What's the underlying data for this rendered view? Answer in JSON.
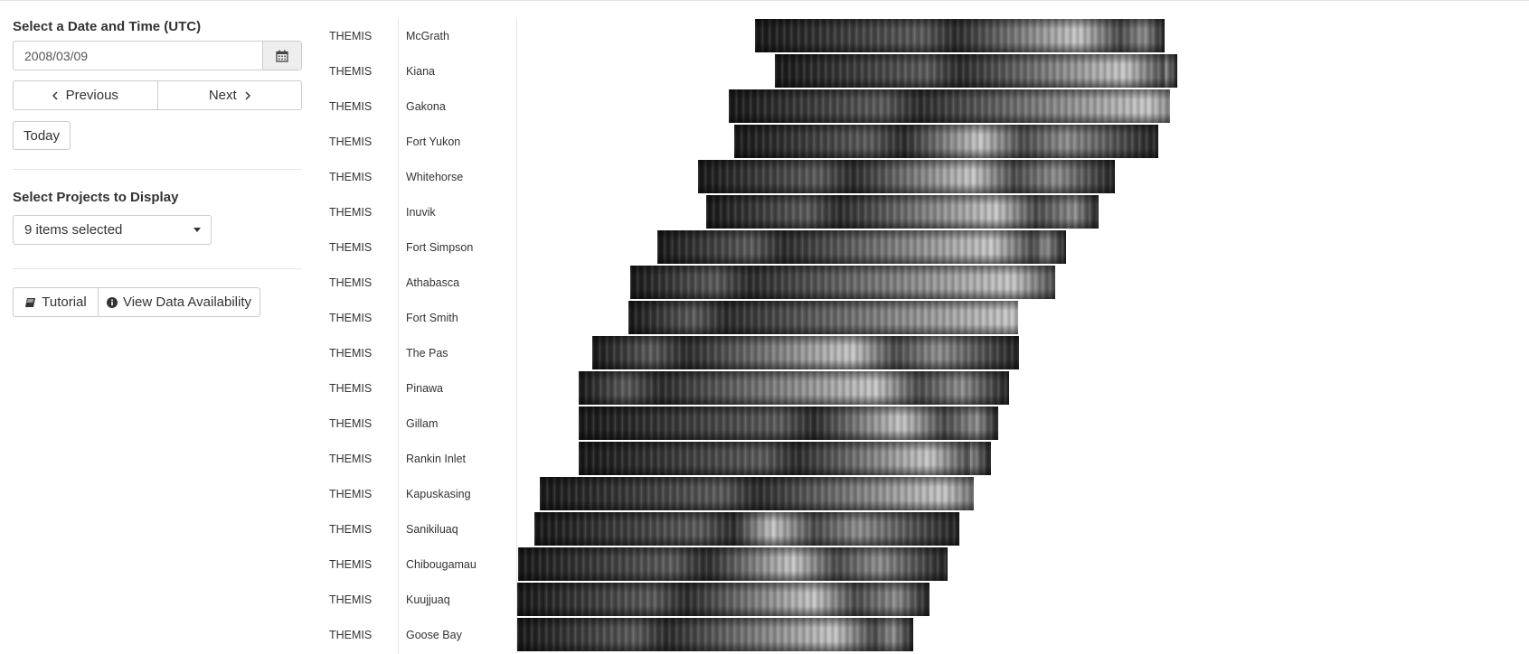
{
  "date_section": {
    "title": "Select a Date and Time (UTC)",
    "date_value": "2008/03/09",
    "calendar_icon": "calendar-icon",
    "previous_label": "Previous",
    "next_label": "Next",
    "today_label": "Today"
  },
  "projects_section": {
    "title": "Select Projects to Display",
    "selected_text": "9 items selected"
  },
  "tools": {
    "tutorial_label": "Tutorial",
    "tutorial_icon": "book-icon",
    "availability_label": "View Data Availability",
    "availability_icon": "info-circle-icon"
  },
  "rows": [
    {
      "project": "THEMIS",
      "site": "McGrath"
    },
    {
      "project": "THEMIS",
      "site": "Kiana"
    },
    {
      "project": "THEMIS",
      "site": "Gakona"
    },
    {
      "project": "THEMIS",
      "site": "Fort Yukon"
    },
    {
      "project": "THEMIS",
      "site": "Whitehorse"
    },
    {
      "project": "THEMIS",
      "site": "Inuvik"
    },
    {
      "project": "THEMIS",
      "site": "Fort Simpson"
    },
    {
      "project": "THEMIS",
      "site": "Athabasca"
    },
    {
      "project": "THEMIS",
      "site": "Fort Smith"
    },
    {
      "project": "THEMIS",
      "site": "The Pas"
    },
    {
      "project": "THEMIS",
      "site": "Pinawa"
    },
    {
      "project": "THEMIS",
      "site": "Gillam"
    },
    {
      "project": "THEMIS",
      "site": "Rankin Inlet"
    },
    {
      "project": "THEMIS",
      "site": "Kapuskasing"
    },
    {
      "project": "THEMIS",
      "site": "Sanikiluaq"
    },
    {
      "project": "THEMIS",
      "site": "Chibougamau"
    },
    {
      "project": "THEMIS",
      "site": "Kuujjuaq"
    },
    {
      "project": "THEMIS",
      "site": "Goose Bay"
    }
  ]
}
